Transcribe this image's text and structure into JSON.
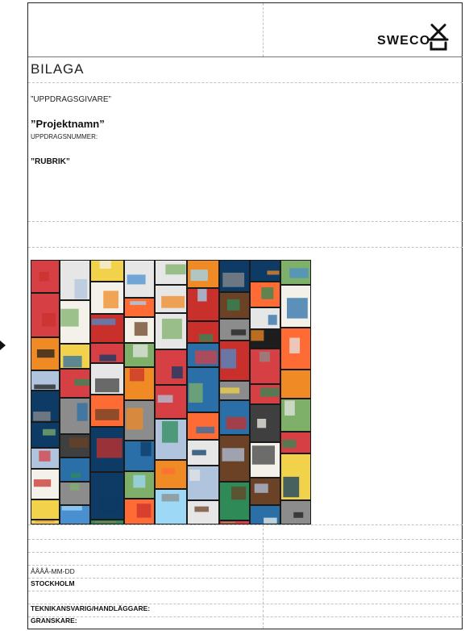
{
  "document": {
    "logo": {
      "text": "SWECO",
      "icon": "sweco-mark-icon"
    },
    "title": "BILAGA",
    "client": "”UPPDRAGSGIVARE”",
    "project_name": "”Projektnamn”",
    "assignment_number_label": "UPPDRAGSNUMMER:",
    "heading": "”RUBRIK”",
    "date": "ÅÅÅÅ-MM-DD",
    "city": "STOCKHOLM",
    "technical_manager_label": "TEKNIKANSVARIG/HANDLÄGGARE:",
    "reviewer_label": "GRANSKARE:"
  },
  "collage": {
    "description_icon": "photo-collage-image",
    "colors": [
      "#2b6fa8",
      "#c9302c",
      "#e6e6e6",
      "#1d1d1d",
      "#f08a24",
      "#4a8fcf",
      "#7fb069",
      "#f2d24b",
      "#8c8c8c",
      "#0d3b66",
      "#d64045",
      "#9ed8f7",
      "#3f3f3f",
      "#f4f1ea",
      "#6b4226",
      "#2e8b57",
      "#b0c4de",
      "#ff6b35"
    ]
  }
}
